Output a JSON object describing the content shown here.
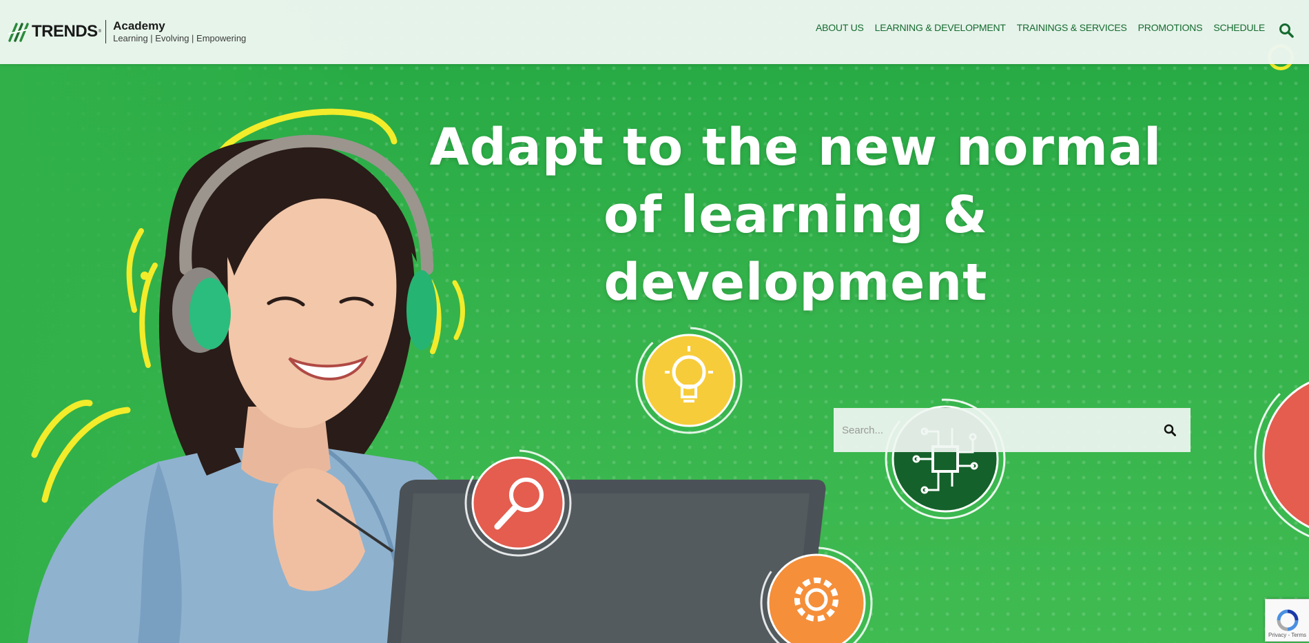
{
  "header": {
    "logo": {
      "brand": "TRENDS",
      "registered": "®",
      "name": "Academy",
      "tagline": "Learning | Evolving | Empowering"
    },
    "nav": [
      {
        "label": "ABOUT US"
      },
      {
        "label": "LEARNING & DEVELOPMENT"
      },
      {
        "label": "TRAININGS & SERVICES"
      },
      {
        "label": "PROMOTIONS"
      },
      {
        "label": "SCHEDULE"
      }
    ],
    "search_icon": "search-icon"
  },
  "hero": {
    "headline_line1": "Adapt to the new normal",
    "headline_line2": "of learning & development",
    "icons": [
      "lightbulb-icon",
      "magnifier-icon",
      "circuit-chip-icon",
      "gear-icon"
    ]
  },
  "search": {
    "placeholder": "Search...",
    "value": ""
  },
  "recaptcha": {
    "text": "Privacy - Terms"
  },
  "colors": {
    "hero_green": "#34b24b",
    "nav_text": "#146a2f",
    "accent_yellow": "#f2ec2a",
    "red_icon": "#e45d4f",
    "orange_icon": "#f58f3a",
    "yellow_icon": "#f7cc3a",
    "dark_green_icon": "#15612b"
  }
}
